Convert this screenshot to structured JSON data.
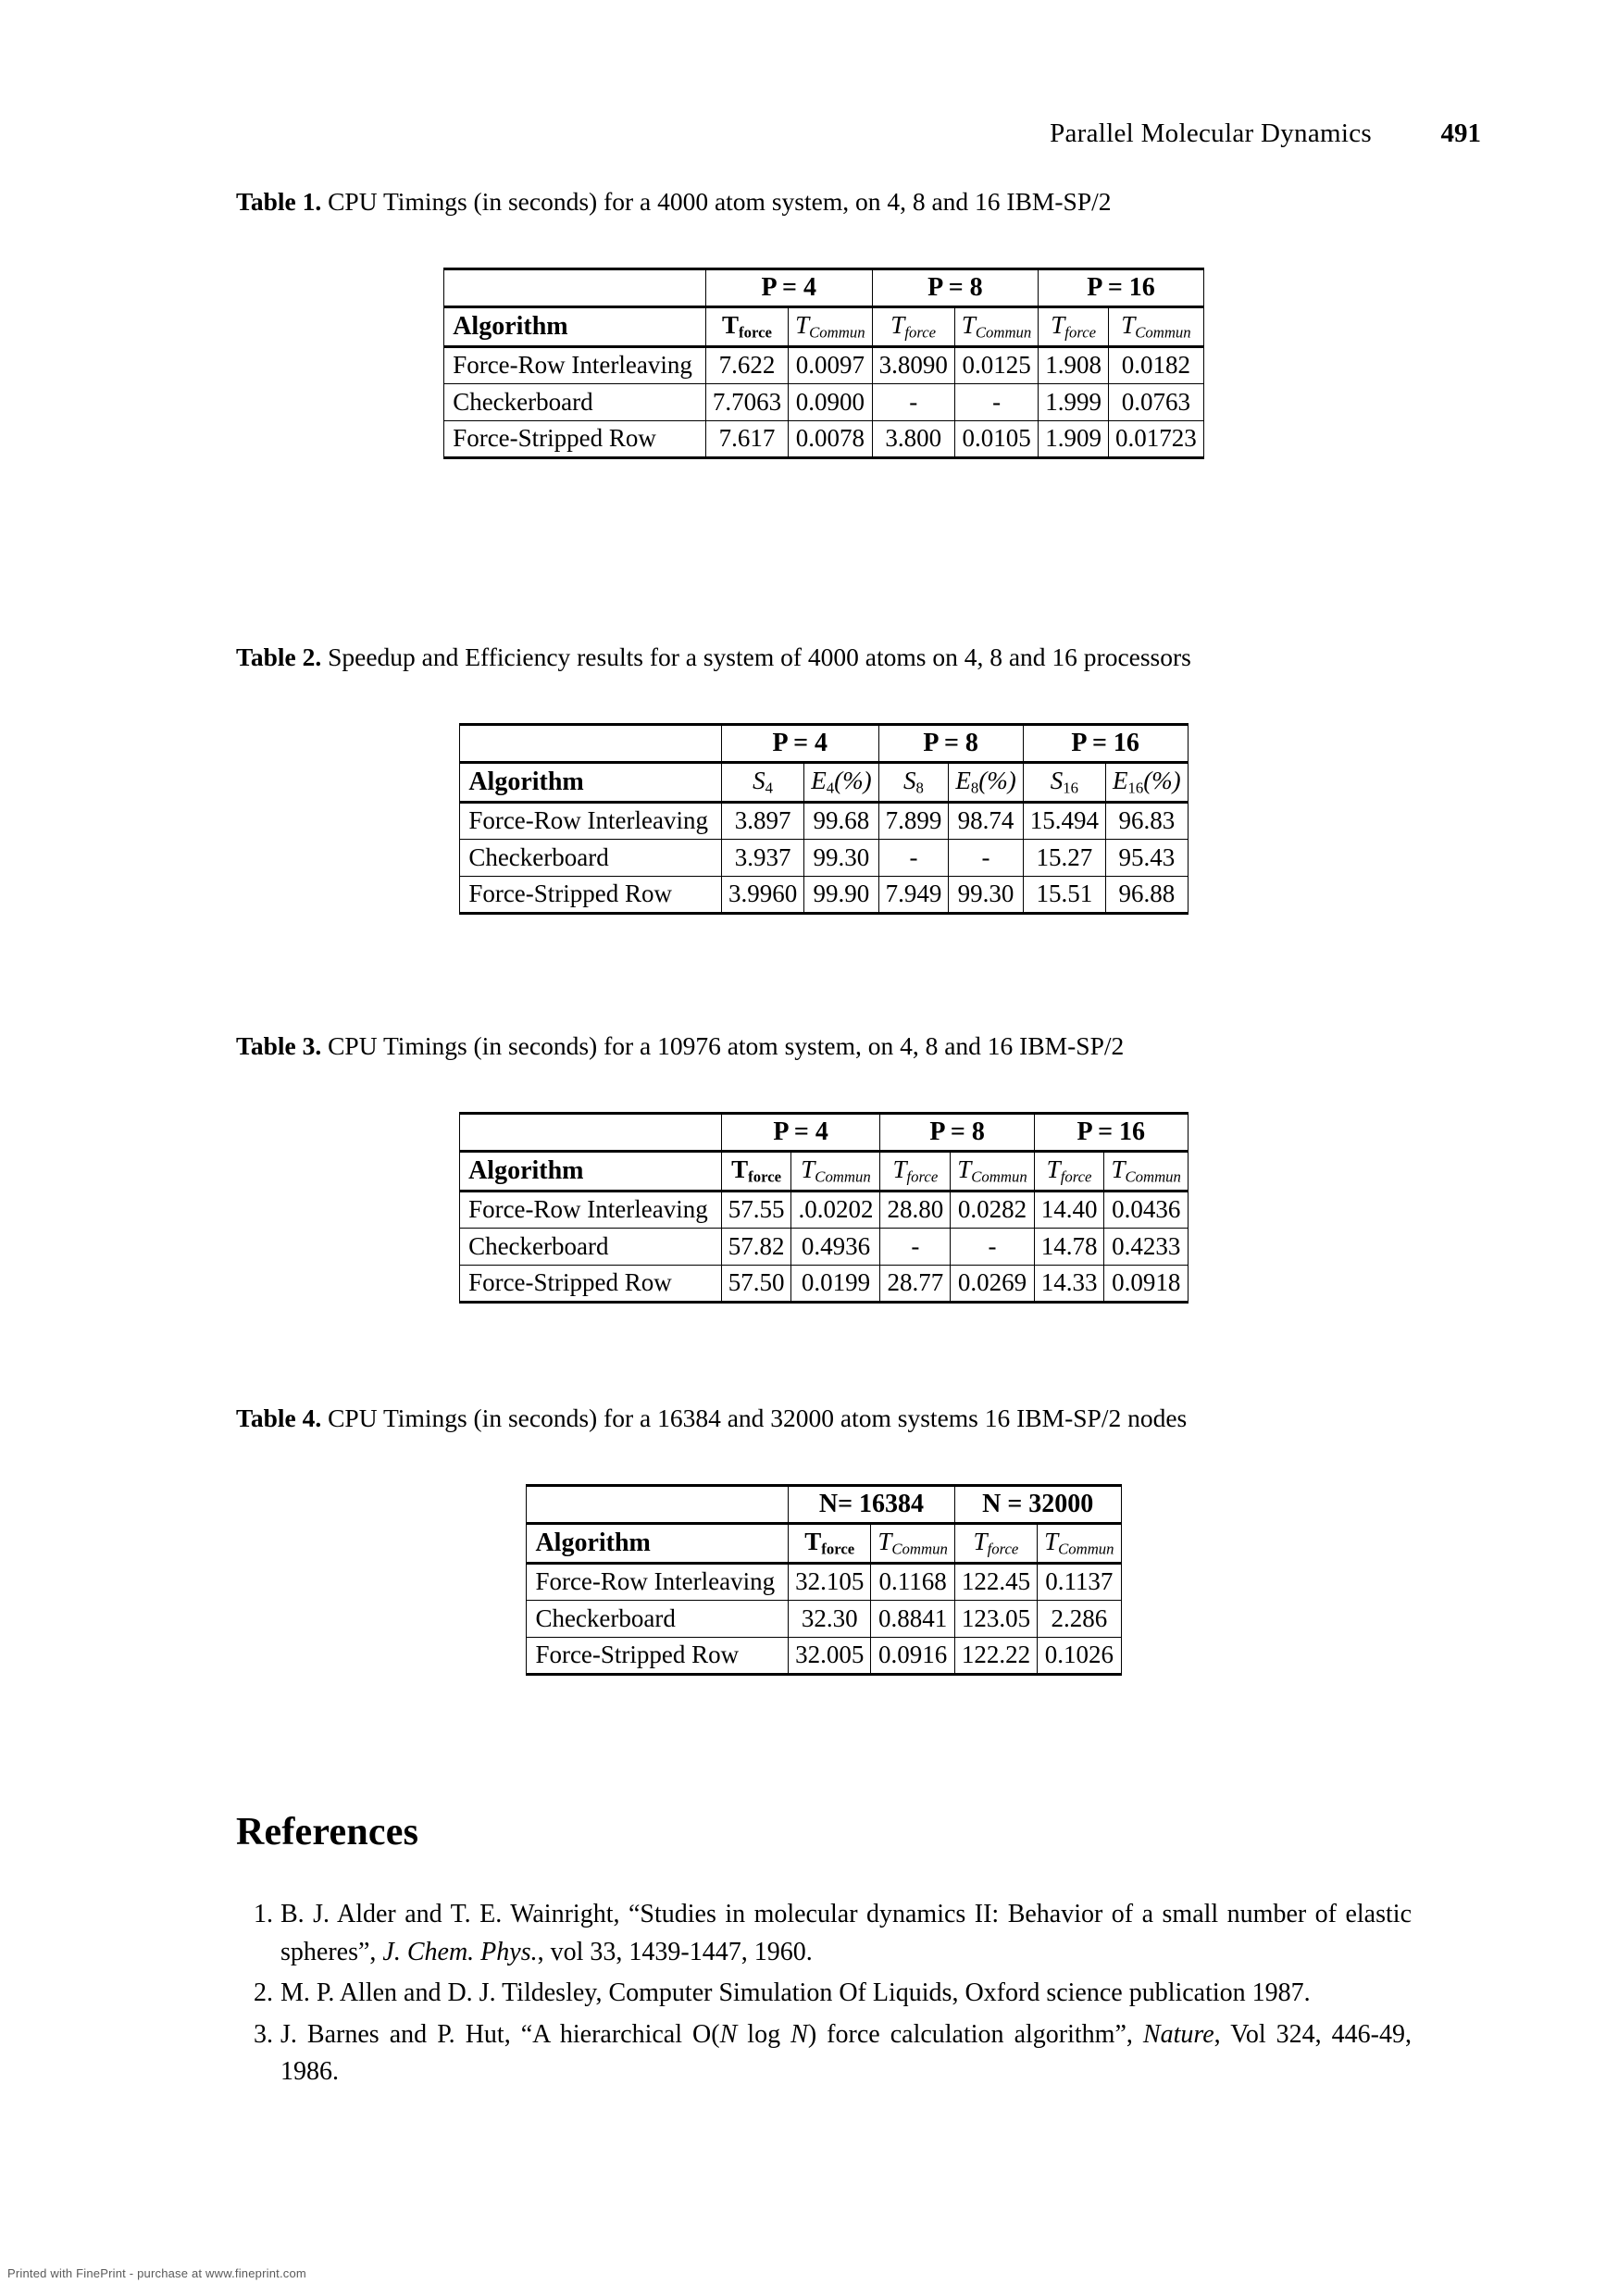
{
  "header": {
    "running_title": "Parallel Molecular Dynamics",
    "page_number": "491"
  },
  "tables": [
    {
      "label": "Table 1.",
      "caption": " CPU Timings (in seconds) for a 4000 atom system, on 4, 8 and 16 IBM-SP/2",
      "group_headers": [
        "P = 4",
        "P = 8",
        "P = 16"
      ],
      "algorithm_header": "Algorithm",
      "sub_headers": [
        "Tforce",
        "TCommun",
        "Tforce",
        "TCommun",
        "Tforce",
        "TCommun"
      ],
      "rows": [
        {
          "algorithm": "Force-Row Interleaving",
          "values": [
            "7.622",
            "0.0097",
            "3.8090",
            "0.0125",
            "1.908",
            "0.0182"
          ]
        },
        {
          "algorithm": "Checkerboard",
          "values": [
            "7.7063",
            "0.0900",
            "-",
            "-",
            "1.999",
            "0.0763"
          ]
        },
        {
          "algorithm": "Force-Stripped Row",
          "values": [
            "7.617",
            "0.0078",
            "3.800",
            "0.0105",
            "1.909",
            "0.01723"
          ]
        }
      ]
    },
    {
      "label": "Table 2.",
      "caption": " Speedup and Efficiency results for a system of 4000 atoms on 4, 8 and 16 processors",
      "group_headers": [
        "P = 4",
        "P = 8",
        "P = 16"
      ],
      "algorithm_header": "Algorithm",
      "sub_headers": [
        "S4",
        "E4(%)",
        "S8",
        "E8(%)",
        "S16",
        "E16(%)"
      ],
      "rows": [
        {
          "algorithm": "Force-Row Interleaving",
          "values": [
            "3.897",
            "99.68",
            "7.899",
            "98.74",
            "15.494",
            "96.83"
          ]
        },
        {
          "algorithm": "Checkerboard",
          "values": [
            "3.937",
            "99.30",
            "-",
            "-",
            "15.27",
            "95.43"
          ]
        },
        {
          "algorithm": "Force-Stripped Row",
          "values": [
            "3.9960",
            "99.90",
            "7.949",
            "99.30",
            "15.51",
            "96.88"
          ]
        }
      ]
    },
    {
      "label": "Table 3.",
      "caption": " CPU Timings (in seconds) for a 10976 atom system, on 4, 8 and 16 IBM-SP/2",
      "group_headers": [
        "P = 4",
        "P = 8",
        "P = 16"
      ],
      "algorithm_header": "Algorithm",
      "sub_headers": [
        "Tforce",
        "TCommun",
        "Tforce",
        "TCommun",
        "Tforce",
        "TCommun"
      ],
      "rows": [
        {
          "algorithm": "Force-Row Interleaving",
          "values": [
            "57.55",
            ".0.0202",
            "28.80",
            "0.0282",
            "14.40",
            "0.0436"
          ]
        },
        {
          "algorithm": "Checkerboard",
          "values": [
            "57.82",
            "0.4936",
            "-",
            "-",
            "14.78",
            "0.4233"
          ]
        },
        {
          "algorithm": "Force-Stripped Row",
          "values": [
            "57.50",
            "0.0199",
            "28.77",
            "0.0269",
            "14.33",
            "0.0918"
          ]
        }
      ]
    },
    {
      "label": "Table 4.",
      "caption": " CPU Timings (in seconds) for a 16384 and 32000 atom systems 16 IBM-SP/2 nodes",
      "group_headers": [
        "N= 16384",
        "N = 32000"
      ],
      "algorithm_header": "Algorithm",
      "sub_headers": [
        "Tforce",
        "TCommun",
        "Tforce",
        "TCommun"
      ],
      "rows": [
        {
          "algorithm": "Force-Row Interleaving",
          "values": [
            "32.105",
            "0.1168",
            "122.45",
            "0.1137"
          ]
        },
        {
          "algorithm": "Checkerboard",
          "values": [
            "32.30",
            "0.8841",
            "123.05",
            "2.286"
          ]
        },
        {
          "algorithm": "Force-Stripped Row",
          "values": [
            "32.005",
            "0.0916",
            "122.22",
            "0.1026"
          ]
        }
      ]
    }
  ],
  "references": {
    "heading": "References",
    "items": [
      {
        "number": "1.",
        "parts": [
          {
            "text": "B. J. Alder and T. E. Wainright, “Studies in molecular dynamics II: Behavior of a small number of elastic spheres”, ",
            "style": "normal"
          },
          {
            "text": "J. Chem. Phys.",
            "style": "italic"
          },
          {
            "text": ", vol 33, 1439-1447, 1960.",
            "style": "normal"
          }
        ]
      },
      {
        "number": "2.",
        "parts": [
          {
            "text": "M. P. Allen and D. J. Tildesley, Computer Simulation Of Liquids, Oxford science publication 1987.",
            "style": "normal"
          }
        ]
      },
      {
        "number": "3.",
        "parts": [
          {
            "text": "J. Barnes and P. Hut, “A hierarchical O(",
            "style": "normal"
          },
          {
            "text": "N",
            "style": "italic"
          },
          {
            "text": " log ",
            "style": "normal"
          },
          {
            "text": "N",
            "style": "italic"
          },
          {
            "text": ") force calculation algorithm”, ",
            "style": "normal"
          },
          {
            "text": "Nature",
            "style": "italic"
          },
          {
            "text": ", Vol 324, 446-49, 1986.",
            "style": "normal"
          }
        ]
      }
    ]
  },
  "footer": {
    "note": "Printed with FinePrint - purchase at www.fineprint.com"
  }
}
